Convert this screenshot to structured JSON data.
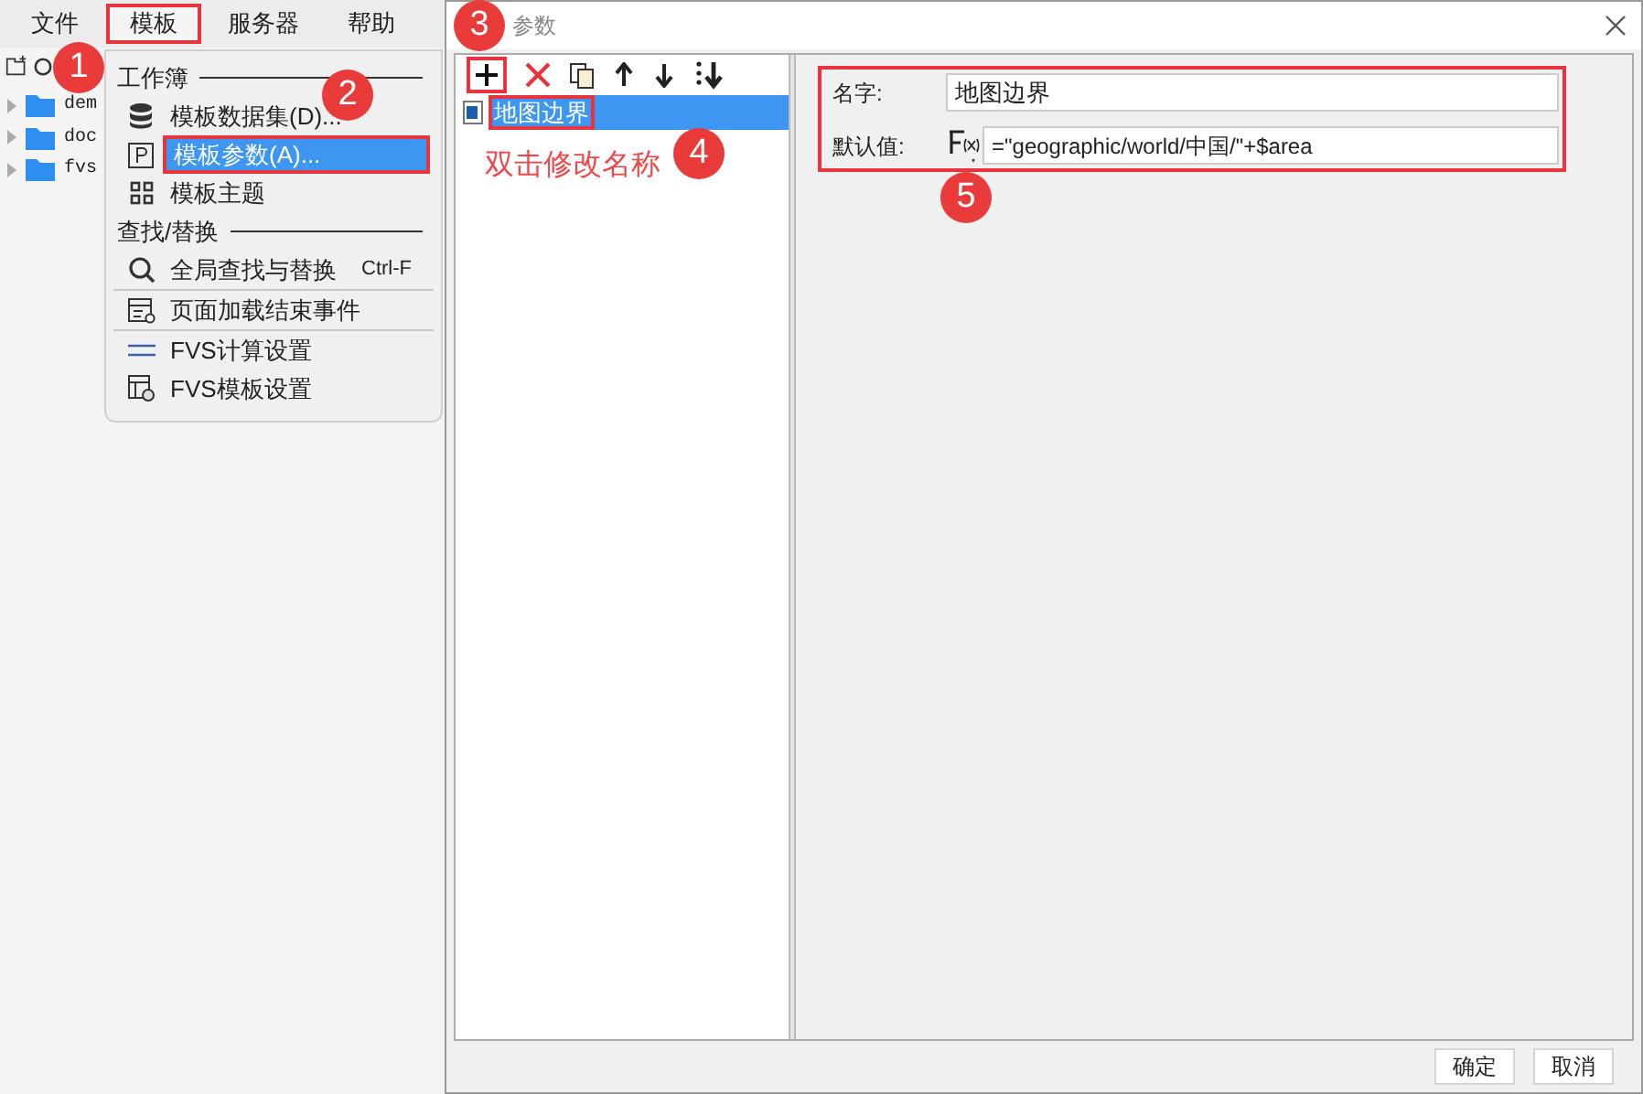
{
  "app": {
    "menu_bar": [
      {
        "label": "文件",
        "selected": false
      },
      {
        "label": "模板",
        "selected": true
      },
      {
        "label": "服务器",
        "selected": false
      },
      {
        "label": "帮助",
        "selected": false
      }
    ],
    "tree": [
      {
        "label": "dem"
      },
      {
        "label": "doc"
      },
      {
        "label": "fvs"
      }
    ]
  },
  "dropdown": {
    "items": [
      {
        "kind": "header",
        "label": "工作簿"
      },
      {
        "kind": "item",
        "label": "模板数据集(D)...",
        "selected": false
      },
      {
        "kind": "item",
        "label": "模板参数(A)...",
        "selected": true
      },
      {
        "kind": "item",
        "label": "模板主题",
        "selected": false
      },
      {
        "kind": "header",
        "label": "查找/替换"
      },
      {
        "kind": "item",
        "label": "全局查找与替换",
        "shortcut": "Ctrl-F",
        "selected": false
      },
      {
        "kind": "separator"
      },
      {
        "kind": "item",
        "label": "页面加载结束事件",
        "selected": false
      },
      {
        "kind": "separator"
      },
      {
        "kind": "item",
        "label": "FVS计算设置",
        "selected": false
      },
      {
        "kind": "item",
        "label": "FVS模板设置",
        "selected": false
      }
    ]
  },
  "dialog": {
    "title": "参数",
    "parameters": [
      {
        "name": "地图边界",
        "selected": true
      }
    ],
    "hint": "双击修改名称",
    "form": {
      "name_label": "名字:",
      "name_value": "地图边界",
      "default_label": "默认值:",
      "default_value": "=\"geographic/world/中国/\"+$area"
    },
    "buttons": [
      "确定",
      "取消"
    ]
  },
  "badges": [
    "1",
    "2",
    "3",
    "4",
    "5"
  ]
}
